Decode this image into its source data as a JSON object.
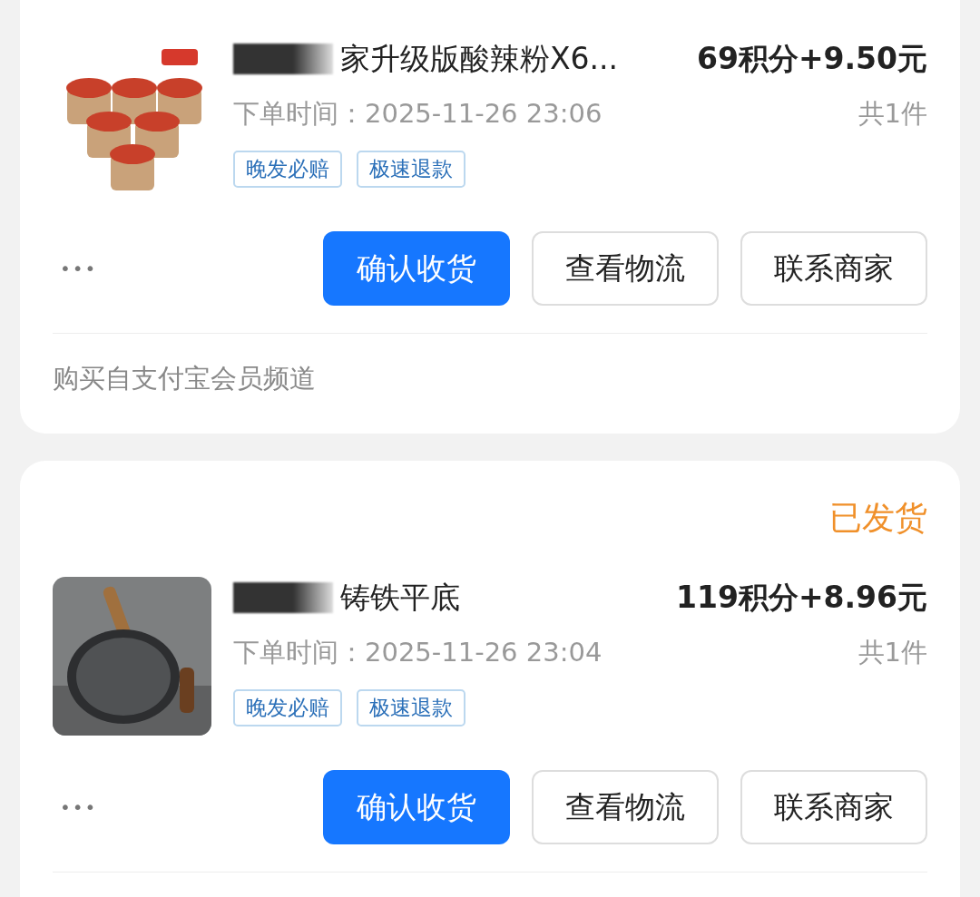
{
  "orders": [
    {
      "picture": {
        "kind": "picture"
      },
      "title": "家升级版酸辣粉X6...",
      "redacted": true,
      "price": "69积分+9.50元",
      "time": "下单时间：2025-11-26 23:06",
      "quantity": "共1件",
      "tags": [
        "晚发必赔",
        "极速退款"
      ],
      "more": "•••",
      "buttons": [
        {
          "label": "确认收货",
          "primary": true
        },
        {
          "label": "查看物流",
          "primary": false
        },
        {
          "label": "联系商家",
          "primary": false
        }
      ],
      "source": "购买自支付宝会员频道"
    },
    {
      "status": "已发货",
      "picture": {
        "kind": "picture"
      },
      "title": "铸铁平底",
      "redacted": true,
      "price": "119积分+8.96元",
      "time": "下单时间：2025-11-26 23:04",
      "quantity": "共1件",
      "tags": [
        "晚发必赔",
        "极速退款"
      ],
      "more": "•••",
      "buttons": [
        {
          "label": "确认收货",
          "primary": true
        },
        {
          "label": "查看物流",
          "primary": false
        },
        {
          "label": "联系商家",
          "primary": false
        }
      ]
    }
  ]
}
